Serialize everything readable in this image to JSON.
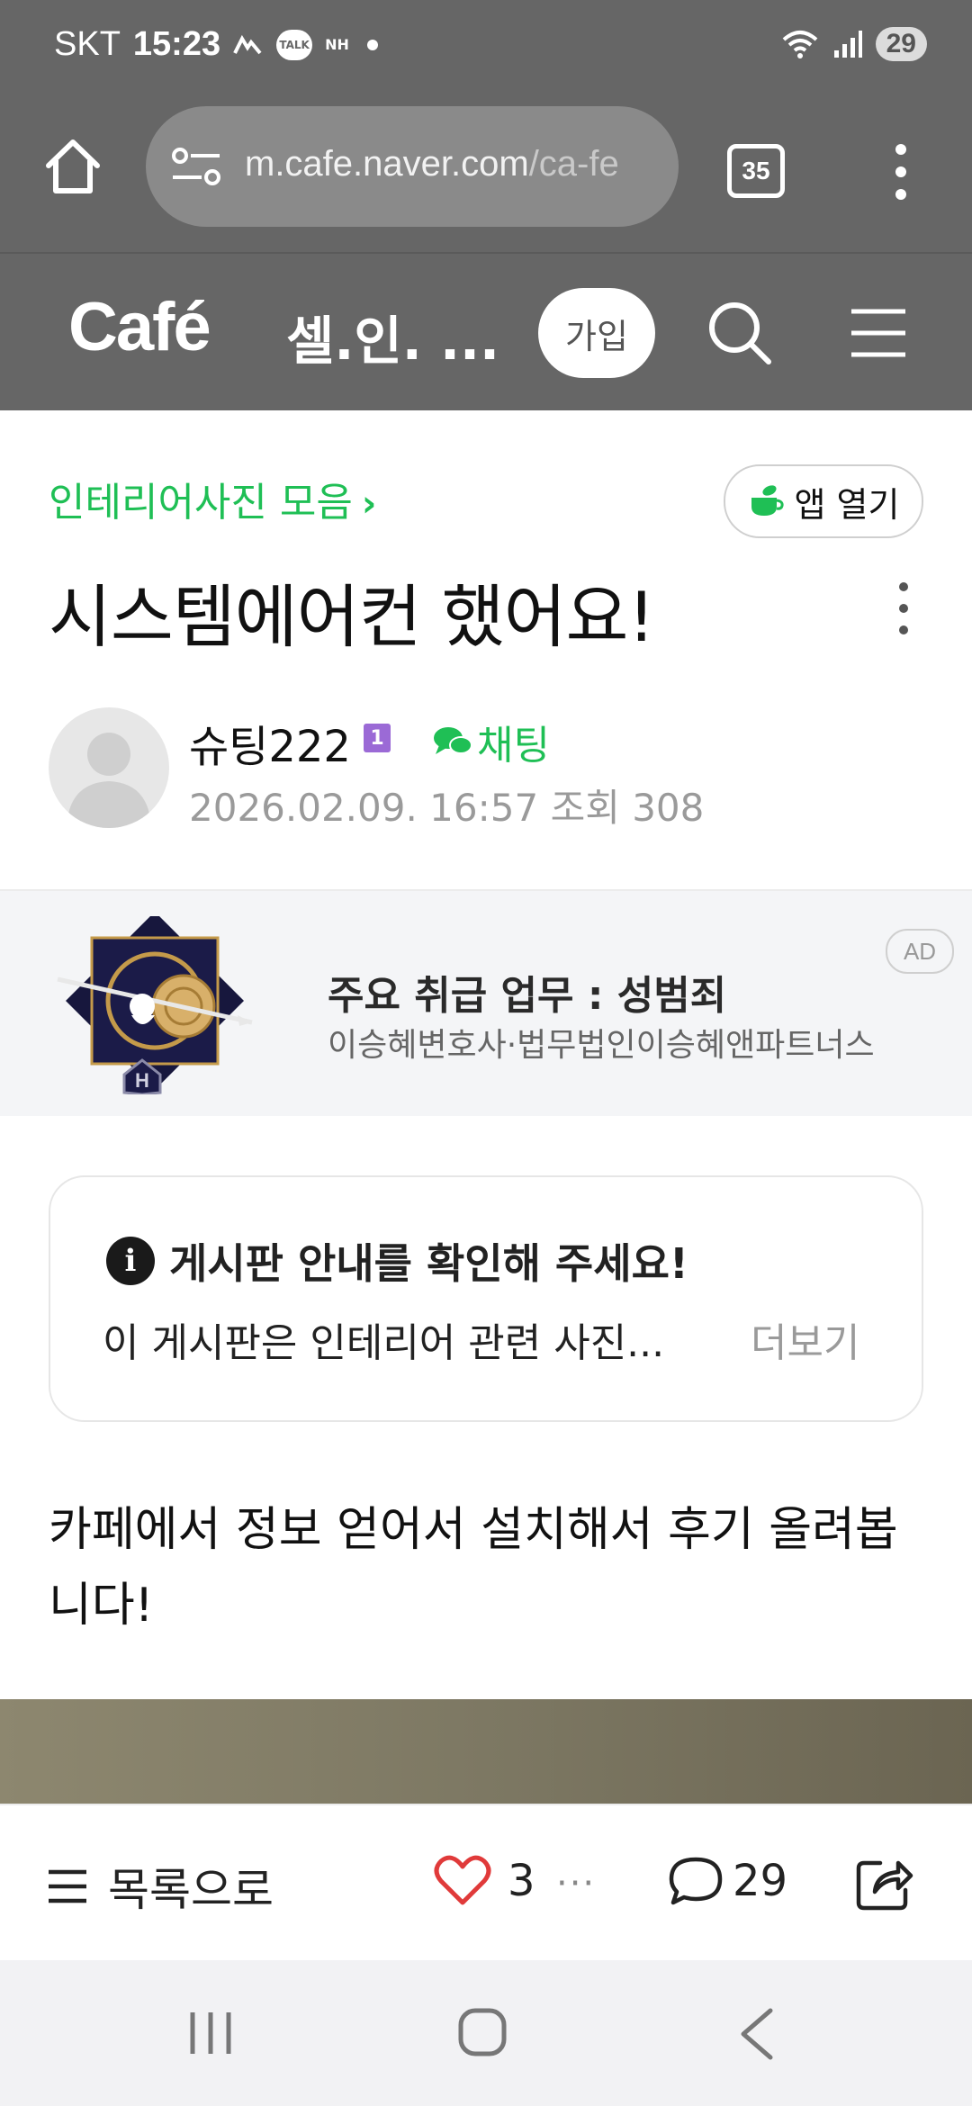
{
  "status_bar": {
    "carrier": "SKT",
    "time": "15:23",
    "talk_label": "TALK",
    "nh_label": "NH",
    "battery": "29"
  },
  "browser": {
    "url_main": "m.cafe.naver.com",
    "url_rest": "/ca-fe",
    "tab_count": "35"
  },
  "cafe_header": {
    "logo": "Café",
    "cafe_name": "셀.인. ...",
    "join_label": "가입"
  },
  "post": {
    "board_name": "인테리어사진 모음",
    "board_chevron": "›",
    "app_open_label": "앱 열기",
    "title": "시스템에어컨 했어요!",
    "author": "슈팅222",
    "author_level": "1",
    "chat_label": "채팅",
    "meta": "2026.02.09. 16:57  조회 308",
    "body_line1": "카페에서 정보 얻어서 설치해서 후기 올려봅",
    "body_line2": "니다!"
  },
  "ad": {
    "title": "주요 취급 업무 : 성범죄",
    "subtitle": "이승혜변호사·법무법인이승혜앤파트너스",
    "badge": "AD"
  },
  "notice": {
    "icon": "i",
    "title": "게시판 안내를 확인해 주세요!",
    "text": "이 게시판은 인테리어 관련 사진...",
    "more_label": "더보기"
  },
  "action_bar": {
    "list_label": "목록으로",
    "like_count": "3",
    "more_label": "···",
    "comment_count": "29"
  },
  "colors": {
    "header_bg": "#666666",
    "accent_green": "#1fbf55",
    "heart_red": "#e03a3a",
    "level_purple": "#9b6ad6"
  },
  "icons": [
    "home-icon",
    "site-settings-icon",
    "tabs-icon",
    "more-vertical-icon",
    "search-icon",
    "hamburger-menu-icon",
    "cup-icon",
    "chat-icon",
    "info-icon",
    "list-icon",
    "heart-icon",
    "comment-icon",
    "share-icon",
    "nav-recent-icon",
    "nav-home-icon",
    "nav-back-icon"
  ]
}
